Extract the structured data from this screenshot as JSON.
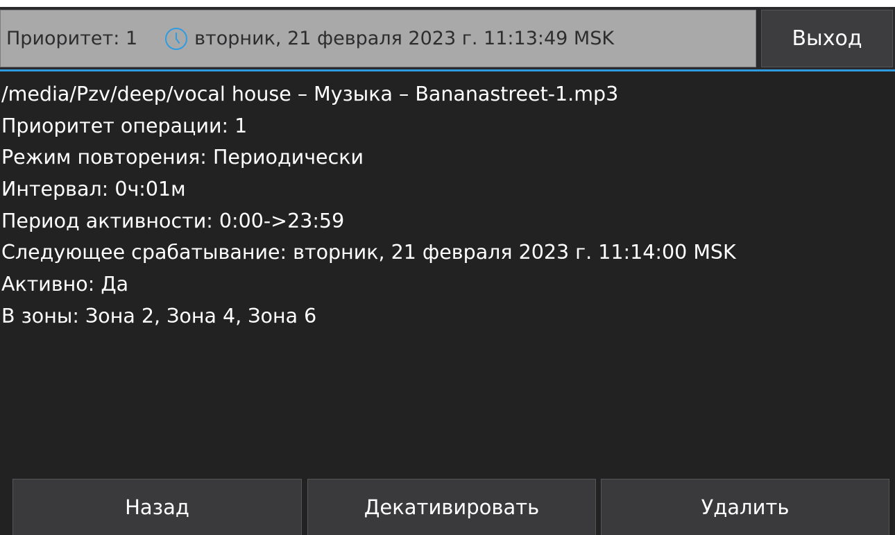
{
  "header": {
    "priority": "Приоритет: 1",
    "datetime": "вторник, 21 февраля 2023 г. 11:13:49 MSK",
    "clock_icon": "clock-icon",
    "exit_label": "Выход"
  },
  "details": {
    "path": "/media/Pzv/deep/vocal house – Музыка – Bananastreet-1.mp3",
    "priority": "Приоритет операции: 1",
    "repeat_mode": "Режим повторения: Периодически",
    "interval": "Интервал: 0ч:01м",
    "active_period": "Период активности: 0:00->23:59",
    "next_trigger": "Следующее срабатывание: вторник, 21 февраля 2023 г. 11:14:00 MSK",
    "active": "Активно: Да",
    "zones": "В зоны: Зона 2, Зона 4, Зона 6"
  },
  "buttons": {
    "back": "Назад",
    "deactivate": "Декативировать",
    "delete": "Удалить"
  },
  "colors": {
    "accent": "#2f9be0",
    "background": "#222222",
    "status_bar": "#a9a9a9"
  }
}
